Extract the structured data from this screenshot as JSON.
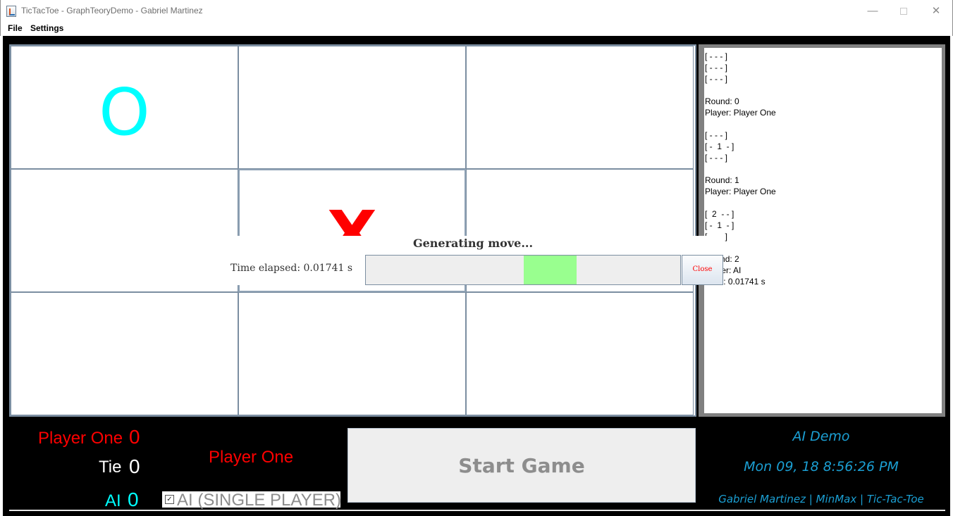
{
  "window": {
    "title": "TicTacToe - GraphTeoryDemo - Gabriel Martinez",
    "minimize_glyph": "—",
    "close_glyph": "✕"
  },
  "menu": {
    "items": [
      {
        "label": "File"
      },
      {
        "label": "Settings"
      }
    ]
  },
  "board": {
    "cells": [
      {
        "mark": "O"
      },
      {
        "mark": ""
      },
      {
        "mark": ""
      },
      {
        "mark": ""
      },
      {
        "mark": "X"
      },
      {
        "mark": ""
      },
      {
        "mark": ""
      },
      {
        "mark": ""
      },
      {
        "mark": ""
      }
    ],
    "o_color": "#00ffff",
    "x_color": "#ff0000"
  },
  "log": {
    "text": "[ - - - ]\n[ - - - ]\n[ - - - ]\n\nRound: 0\nPlayer: Player One\n\n[ - - - ]\n[ -  1  - ]\n[ - - - ]\n\nRound: 1\nPlayer: Player One\n\n[  2  - - ]\n[ -  1  - ]\n[ - - - ]\n\nRound: 2\nPlayer: AI\nTime: 0.01741 s"
  },
  "dialog": {
    "title": "Generating move...",
    "time_text": "Time elapsed: 0.01741 s",
    "close_label": "Close",
    "progress_indeterminate_position": 0.5,
    "progress_color": "#99ff8f"
  },
  "scoreboard": {
    "player_one": {
      "label": "Player One",
      "value": "0",
      "color": "#ff0000"
    },
    "tie": {
      "label": "Tie",
      "value": "0",
      "color": "#ffffff"
    },
    "ai": {
      "label": "AI",
      "value": "0",
      "color": "#00ffff"
    },
    "current_player": "Player One",
    "ai_checkbox": {
      "label": "AI (SINGLE PLAYER)",
      "checked": true,
      "check_glyph": "✓"
    }
  },
  "start_button": {
    "label": "Start Game"
  },
  "info": {
    "title": "AI Demo",
    "datetime": "Mon 09, 18 8:56:26 PM",
    "credit": "Gabriel Martinez | MinMax | Tic-Tac-Toe",
    "color": "#1b9fd3"
  }
}
